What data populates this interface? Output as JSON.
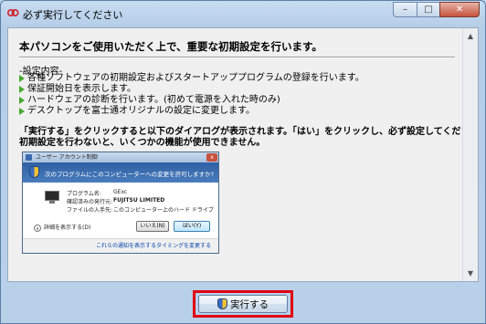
{
  "window": {
    "title": "必ず実行してください",
    "controls": {
      "minimize": "–",
      "maximize": "□",
      "close": "✕"
    }
  },
  "content": {
    "heading": "本パソコンをご使用いただく上で、重要な初期設定を行います。",
    "section_label": "-設定内容-",
    "items": [
      "各種ソフトウェアの初期設定およびスタートアッププログラムの登録を行います。",
      "保証開始日を表示します。",
      "ハードウェアの診断を行います。(初めて電源を入れた時のみ)",
      "デスクトップを富士通オリジナルの設定に変更します。"
    ],
    "note_line1": "「実行する」をクリックすると以下のダイアログが表示されます。「はい」をクリックし、必ず設定してください。",
    "note_line2": "初期設定を行わないと、いくつかの機能が使用できません。"
  },
  "uac": {
    "title": "ユーザー アカウント制御",
    "question": "次のプログラムにこのコンピューターへの変更を許可しますか?",
    "program_label": "プログラム名:",
    "program_value": "GExc",
    "publisher_label": "確認済みの発行元:",
    "publisher_value": "FUJITSU LIMITED",
    "origin_label": "ファイルの入手先:",
    "origin_value": "このコンピューター上のハード ドライブ",
    "details": "詳細を表示する(D)",
    "no": "いいえ(N)",
    "yes": "はい(Y)",
    "footer_link": "これらの通知を表示するタイミングを変更する",
    "close": "x"
  },
  "execute_button": {
    "label": "実行する"
  },
  "colors": {
    "highlight": "#e00012",
    "bullet": "#46a82f",
    "uac_band": "#2e5fa3"
  }
}
